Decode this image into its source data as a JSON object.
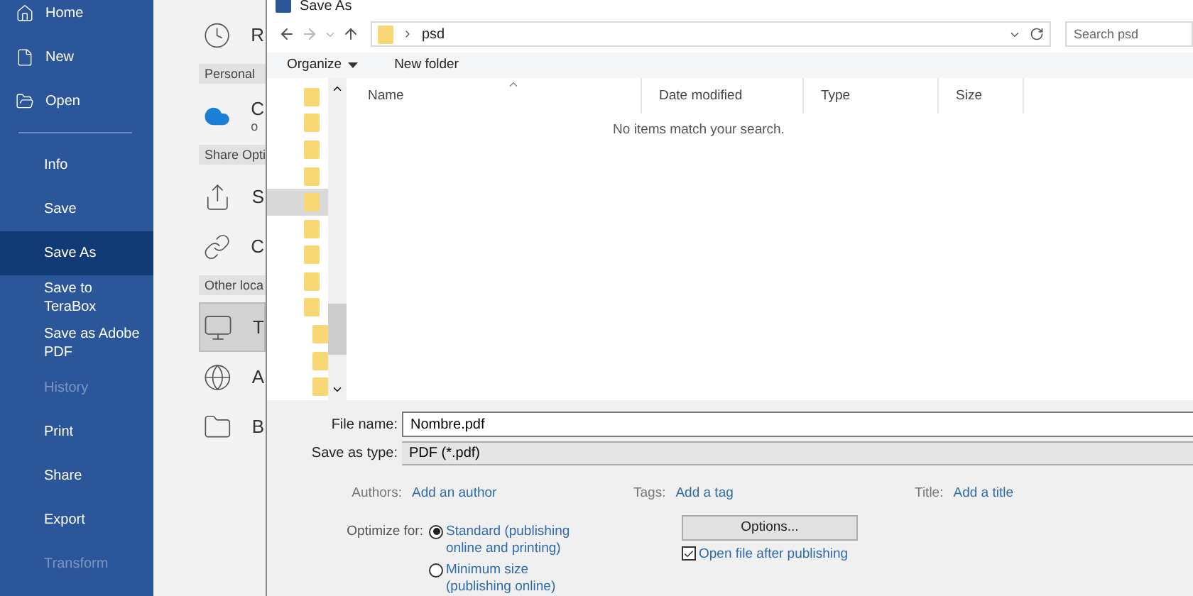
{
  "sidebar": {
    "top_items": [
      {
        "label": "Home",
        "selected": false,
        "disabled": false
      },
      {
        "label": "New",
        "selected": false,
        "disabled": false
      },
      {
        "label": "Open",
        "selected": false,
        "disabled": false
      }
    ],
    "items": [
      {
        "label": "Info",
        "selected": false,
        "disabled": false
      },
      {
        "label": "Save",
        "selected": false,
        "disabled": false
      },
      {
        "label": "Save As",
        "selected": true,
        "disabled": false
      },
      {
        "label": "Save to TeraBox",
        "selected": false,
        "disabled": false
      },
      {
        "label": "Save as Adobe PDF",
        "selected": false,
        "disabled": false
      },
      {
        "label": "History",
        "selected": false,
        "disabled": true
      },
      {
        "label": "Print",
        "selected": false,
        "disabled": false
      },
      {
        "label": "Share",
        "selected": false,
        "disabled": false
      },
      {
        "label": "Export",
        "selected": false,
        "disabled": false
      },
      {
        "label": "Transform",
        "selected": false,
        "disabled": true
      }
    ]
  },
  "locations": [
    {
      "kind": "place",
      "label": "R",
      "selected": false
    },
    {
      "kind": "header",
      "label": "Personal"
    },
    {
      "kind": "place",
      "label": "C",
      "sublabel": "o",
      "selected": false
    },
    {
      "kind": "header",
      "label": "Share Opti"
    },
    {
      "kind": "place",
      "label": "S",
      "selected": false
    },
    {
      "kind": "place",
      "label": "C",
      "selected": false
    },
    {
      "kind": "header",
      "label": "Other loca"
    },
    {
      "kind": "place",
      "label": "T",
      "selected": true
    },
    {
      "kind": "place",
      "label": "A",
      "selected": false
    },
    {
      "kind": "place",
      "label": "B",
      "selected": false
    }
  ],
  "dialog": {
    "title": "Save As",
    "address": {
      "path": "psd"
    },
    "search": {
      "placeholder": "Search psd"
    },
    "toolbar": [
      {
        "label": "Organize",
        "kind": "menu"
      },
      {
        "label": "New folder",
        "kind": "button"
      }
    ],
    "tree": [
      {
        "selected": false
      },
      {
        "selected": false
      },
      {
        "selected": false
      },
      {
        "selected": false
      },
      {
        "selected": true
      },
      {
        "selected": false
      },
      {
        "selected": false
      },
      {
        "selected": false
      },
      {
        "selected": false,
        "children": [
          {
            "selected": false
          },
          {
            "selected": false
          },
          {
            "selected": false
          }
        ]
      }
    ],
    "columns": [
      "Name",
      "Date modified",
      "Type",
      "Size"
    ],
    "empty_message": "No items match your search.",
    "file_name": {
      "label": "File name:",
      "value": "Nombre.pdf"
    },
    "save_as_type": {
      "label": "Save as type:",
      "value": "PDF (*.pdf)"
    },
    "metadata": [
      {
        "label": "Authors:",
        "link": "Add an author"
      },
      {
        "label": "Tags:",
        "link": "Add a tag"
      },
      {
        "label": "Title:",
        "link": "Add a title"
      }
    ],
    "optimize": {
      "label": "Optimize for:",
      "options": [
        {
          "label": "Standard (publishing online and printing)",
          "selected": true
        },
        {
          "label": "Minimum size (publishing online)",
          "selected": false
        }
      ]
    },
    "options_button": "Options...",
    "open_after": {
      "label": "Open file after publishing",
      "checked": true
    }
  }
}
